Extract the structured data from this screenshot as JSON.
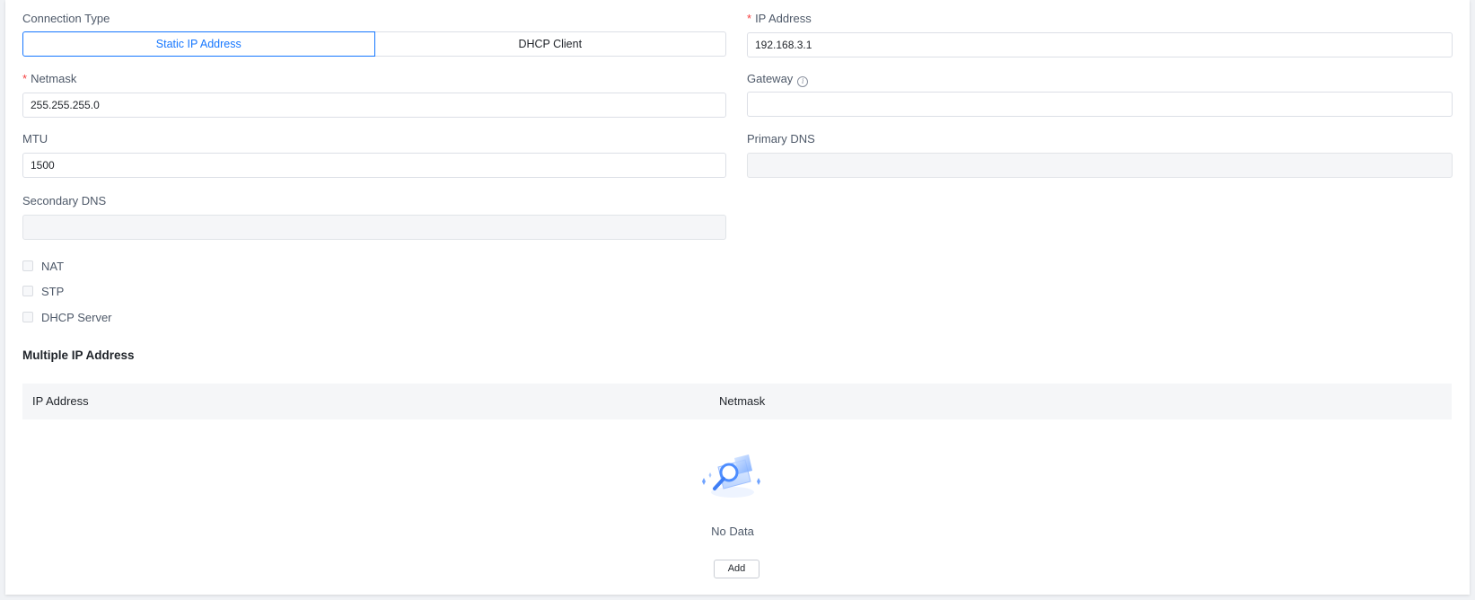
{
  "form": {
    "connection_type": {
      "label": "Connection Type",
      "options": [
        "Static IP Address",
        "DHCP Client"
      ],
      "selected": "Static IP Address"
    },
    "ip_address": {
      "label": "IP Address",
      "required": true,
      "value": "192.168.3.1"
    },
    "netmask": {
      "label": "Netmask",
      "required": true,
      "value": "255.255.255.0"
    },
    "gateway": {
      "label": "Gateway",
      "value": ""
    },
    "mtu": {
      "label": "MTU",
      "value": "1500"
    },
    "primary_dns": {
      "label": "Primary DNS",
      "value": "",
      "disabled": true
    },
    "secondary_dns": {
      "label": "Secondary DNS",
      "value": "",
      "disabled": true
    },
    "required_mark": "*",
    "checkboxes": [
      {
        "label": "NAT",
        "checked": false
      },
      {
        "label": "STP",
        "checked": false
      },
      {
        "label": "DHCP Server",
        "checked": false
      }
    ]
  },
  "multiple_ip": {
    "title": "Multiple IP Address",
    "columns": [
      "IP Address",
      "Netmask"
    ],
    "rows": [],
    "empty_text": "No Data",
    "add_label": "Add"
  },
  "icons": {
    "gateway_info": "info-circle-icon",
    "empty_state": "empty-search-illustration-icon"
  },
  "colors": {
    "accent": "#1677ff",
    "required": "#f53f3f",
    "disabled_bg": "#f5f6f8"
  }
}
